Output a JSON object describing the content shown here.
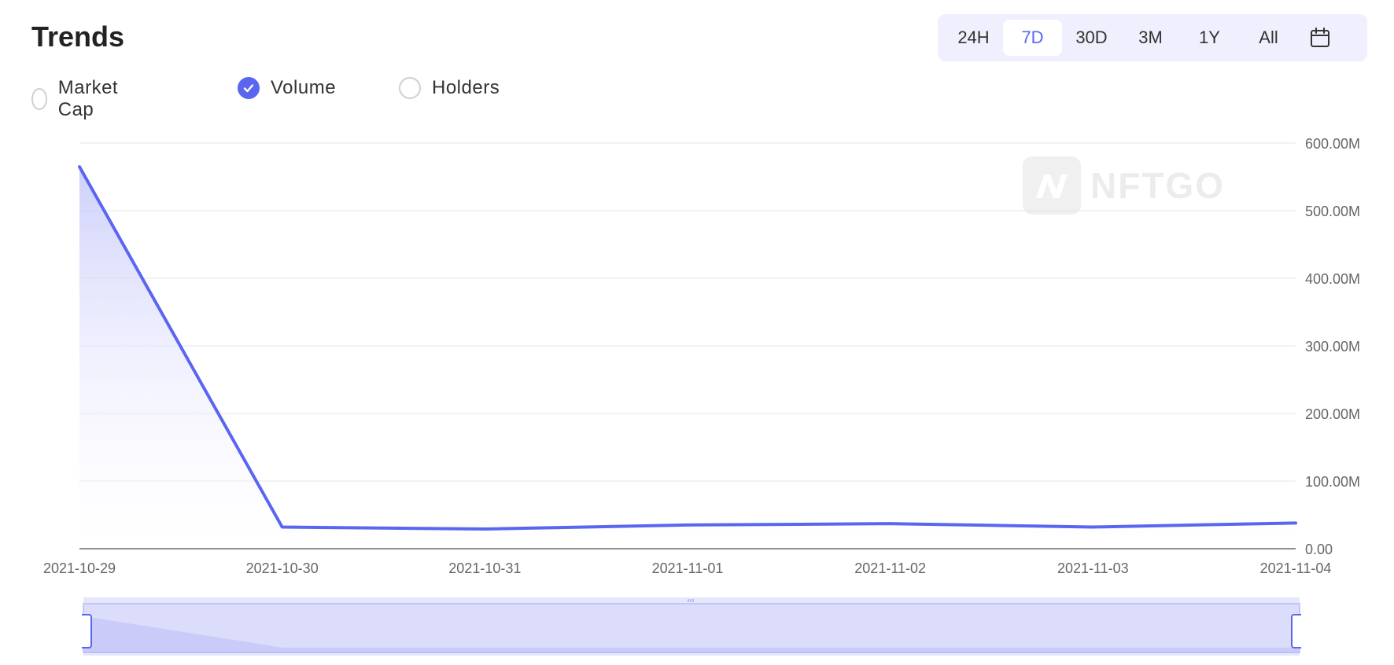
{
  "header": {
    "title": "Trends"
  },
  "range": {
    "options": [
      "24H",
      "7D",
      "30D",
      "3M",
      "1Y",
      "All"
    ],
    "active": "7D",
    "calendar_icon": "calendar-icon"
  },
  "metrics": {
    "options": [
      {
        "label": "Market Cap",
        "checked": false
      },
      {
        "label": "Volume",
        "checked": true
      },
      {
        "label": "Holders",
        "checked": false
      }
    ]
  },
  "watermark": {
    "text": "NFTGO"
  },
  "colors": {
    "accent": "#5a66f0",
    "grid": "#e6e6e6",
    "axis": "#555555",
    "fill": "#dcdcfb"
  },
  "chart_data": {
    "type": "area",
    "categories": [
      "2021-10-29",
      "2021-10-30",
      "2021-10-31",
      "2021-11-01",
      "2021-11-02",
      "2021-11-03",
      "2021-11-04"
    ],
    "series": [
      {
        "values": [
          565000000,
          32000000,
          29000000,
          35000000,
          37000000,
          32000000,
          38000000
        ]
      }
    ],
    "y_ticks": [
      "0.00",
      "100.00M",
      "200.00M",
      "300.00M",
      "400.00M",
      "500.00M",
      "600.00M"
    ],
    "ylim": [
      0,
      600000000
    ],
    "y_axis_position": "right",
    "grid": true
  }
}
